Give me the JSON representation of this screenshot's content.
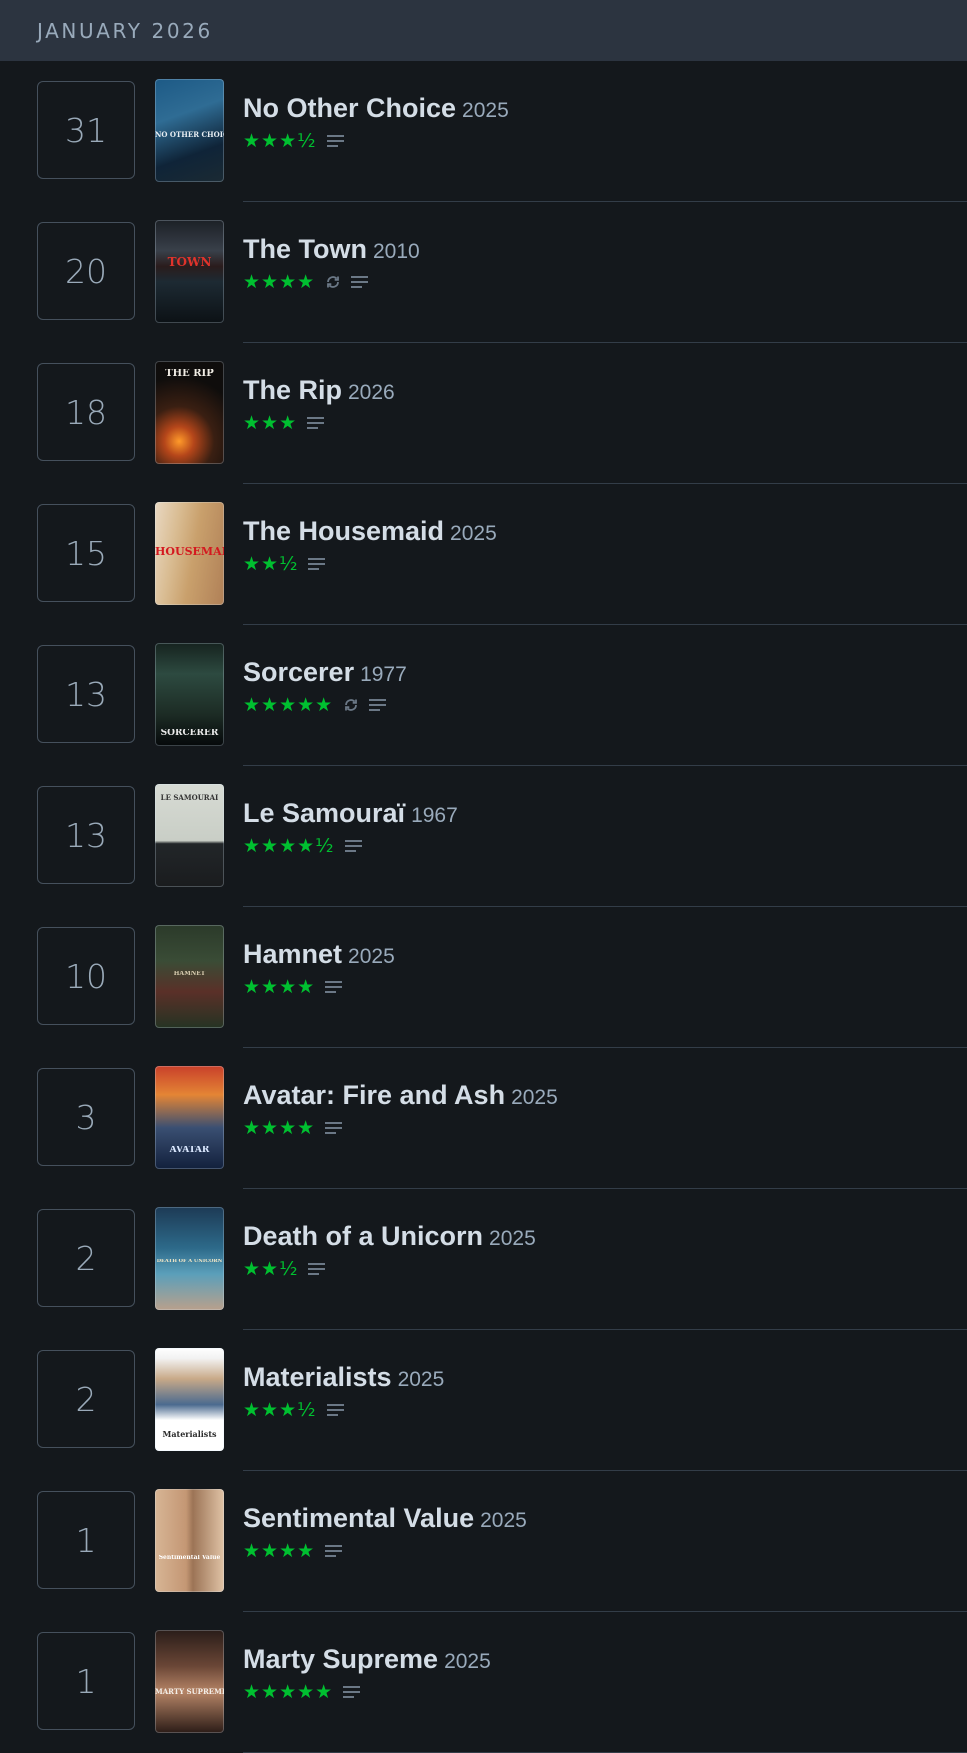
{
  "diary": {
    "month_header": "JANUARY 2026",
    "entries": [
      {
        "day": "31",
        "title": "No Other Choice",
        "year": "2025",
        "stars": "★★★½",
        "rewatch": false,
        "review": true,
        "poster_caption": "NO OTHER CHOICE"
      },
      {
        "day": "20",
        "title": "The Town",
        "year": "2010",
        "stars": "★★★★",
        "rewatch": true,
        "review": true,
        "poster_caption": "TOWN"
      },
      {
        "day": "18",
        "title": "The Rip",
        "year": "2026",
        "stars": "★★★",
        "rewatch": false,
        "review": true,
        "poster_caption": "THE RIP"
      },
      {
        "day": "15",
        "title": "The Housemaid",
        "year": "2025",
        "stars": "★★½",
        "rewatch": false,
        "review": true,
        "poster_caption": "HOUSEMAID"
      },
      {
        "day": "13",
        "title": "Sorcerer",
        "year": "1977",
        "stars": "★★★★★",
        "rewatch": true,
        "review": true,
        "poster_caption": "SORCERER"
      },
      {
        "day": "13",
        "title": "Le Samouraï",
        "year": "1967",
        "stars": "★★★★½",
        "rewatch": false,
        "review": true,
        "poster_caption": "LE SAMOURAÏ"
      },
      {
        "day": "10",
        "title": "Hamnet",
        "year": "2025",
        "stars": "★★★★",
        "rewatch": false,
        "review": true,
        "poster_caption": "HAMNET"
      },
      {
        "day": "3",
        "title": "Avatar: Fire and Ash",
        "year": "2025",
        "stars": "★★★★",
        "rewatch": false,
        "review": true,
        "poster_caption": "AVATAR"
      },
      {
        "day": "2",
        "title": "Death of a Unicorn",
        "year": "2025",
        "stars": "★★½",
        "rewatch": false,
        "review": true,
        "poster_caption": "DEATH OF A UNICORN"
      },
      {
        "day": "2",
        "title": "Materialists",
        "year": "2025",
        "stars": "★★★½",
        "rewatch": false,
        "review": true,
        "poster_caption": "Materialists"
      },
      {
        "day": "1",
        "title": "Sentimental Value",
        "year": "2025",
        "stars": "★★★★",
        "rewatch": false,
        "review": true,
        "poster_caption": "Sentimental Value"
      },
      {
        "day": "1",
        "title": "Marty Supreme",
        "year": "2025",
        "stars": "★★★★★",
        "rewatch": false,
        "review": true,
        "poster_caption": "MARTY SUPREME"
      }
    ]
  },
  "colors": {
    "background": "#14181c",
    "header_background": "#2c3440",
    "star_green": "#00c030",
    "title_text": "#d4dde6",
    "muted_text": "#99aabb",
    "icon_gray": "#6b7886"
  },
  "icons": {
    "rewatch": "rewatch-icon",
    "review": "review-lines-icon"
  }
}
